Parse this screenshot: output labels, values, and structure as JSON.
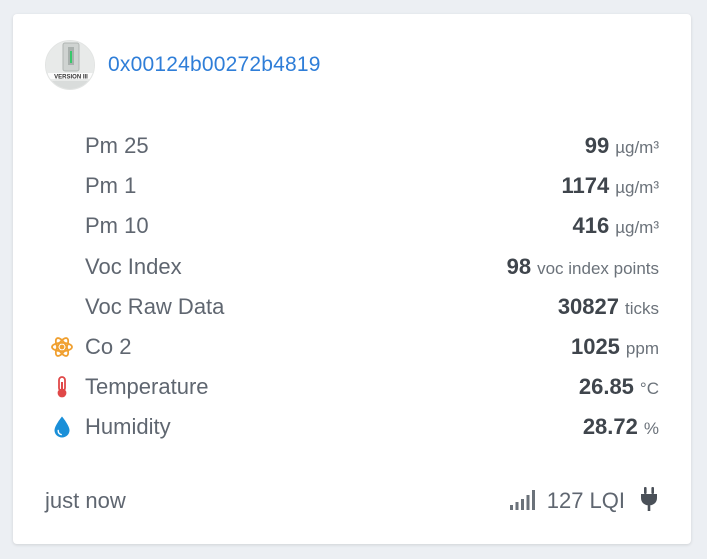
{
  "device": {
    "id": "0x00124b00272b4819",
    "avatar_caption": "VERSION III"
  },
  "metrics": [
    {
      "label": "Pm 25",
      "value": "99",
      "unit": "µg/m³",
      "icon": ""
    },
    {
      "label": "Pm 1",
      "value": "1174",
      "unit": "µg/m³",
      "icon": ""
    },
    {
      "label": "Pm 10",
      "value": "416",
      "unit": "µg/m³",
      "icon": ""
    },
    {
      "label": "Voc Index",
      "value": "98",
      "unit": "voc index points",
      "icon": ""
    },
    {
      "label": "Voc Raw Data",
      "value": "30827",
      "unit": "ticks",
      "icon": ""
    },
    {
      "label": "Co 2",
      "value": "1025",
      "unit": "ppm",
      "icon": "atom-icon"
    },
    {
      "label": "Temperature",
      "value": "26.85",
      "unit": "°C",
      "icon": "thermometer-icon"
    },
    {
      "label": "Humidity",
      "value": "28.72",
      "unit": "%",
      "icon": "water-drop-icon"
    }
  ],
  "footer": {
    "last_seen": "just now",
    "lqi": "127 LQI",
    "signal_icon": "signal-bars-icon",
    "power_icon": "plug-icon"
  },
  "colors": {
    "link": "#2f7ed8",
    "atom": "#f0a030",
    "thermometer": "#e04848",
    "water": "#1a8fd8"
  }
}
